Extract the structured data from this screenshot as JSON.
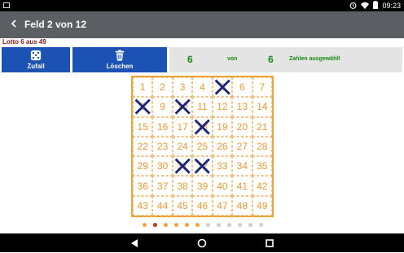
{
  "status_bar": {
    "time": "09:23",
    "icons": [
      "picture-icon",
      "alarm-icon",
      "wifi-icon",
      "battery-icon"
    ]
  },
  "app_bar": {
    "title": "Feld 2 von 12",
    "back_icon": "back-chevron-icon"
  },
  "subtitle": "Lotto 6 aus 49",
  "buttons": {
    "zufall": "Zufall",
    "loeschen": "Löschen"
  },
  "counter": {
    "selected": "6",
    "of": "von",
    "total": "6",
    "label": "Zahlen ausgewählt"
  },
  "numbers": [
    1,
    2,
    3,
    4,
    5,
    6,
    7,
    8,
    9,
    10,
    11,
    12,
    13,
    14,
    15,
    16,
    17,
    18,
    19,
    20,
    21,
    22,
    23,
    24,
    25,
    26,
    27,
    28,
    29,
    30,
    31,
    32,
    33,
    34,
    35,
    36,
    37,
    38,
    39,
    40,
    41,
    42,
    43,
    44,
    45,
    46,
    47,
    48,
    49
  ],
  "selected_numbers": [
    5,
    8,
    10,
    18,
    31,
    32
  ],
  "pagination": {
    "total": 12,
    "current": 2,
    "filled": [
      1,
      3,
      4,
      5,
      6
    ]
  },
  "colors": {
    "accent": "#f0a33a",
    "button": "#1c52b4",
    "cross": "#1a237e",
    "counter_text": "#178a17",
    "appbar": "#5b5e63"
  }
}
